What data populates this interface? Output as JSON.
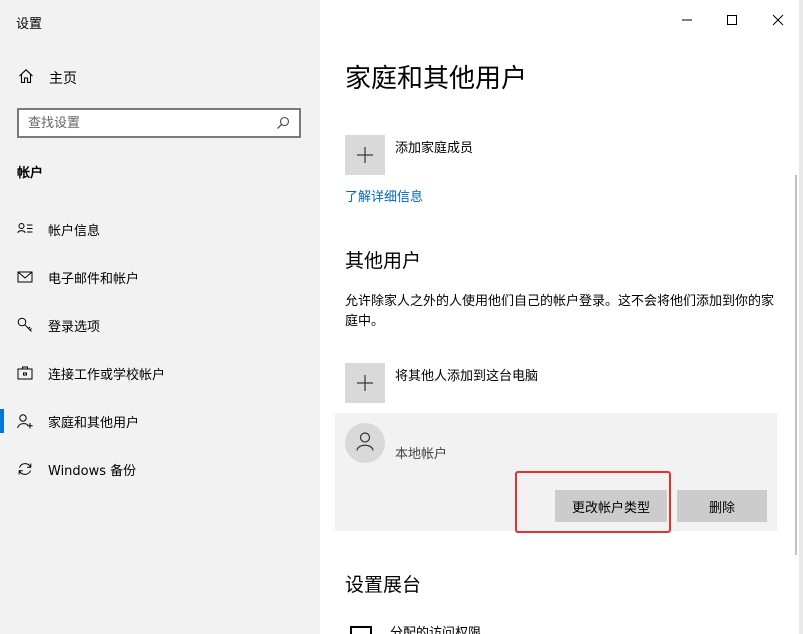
{
  "window": {
    "title": "设置",
    "controls": {
      "minimize": "minimize-icon",
      "maximize": "maximize-icon",
      "close": "close-icon"
    }
  },
  "sidebar": {
    "home_label": "主页",
    "search_placeholder": "查找设置",
    "section_label": "帐户",
    "items": [
      {
        "label": "帐户信息",
        "icon": "account-info-icon"
      },
      {
        "label": "电子邮件和帐户",
        "icon": "mail-icon"
      },
      {
        "label": "登录选项",
        "icon": "key-icon"
      },
      {
        "label": "连接工作或学校帐户",
        "icon": "briefcase-icon"
      },
      {
        "label": "家庭和其他用户",
        "icon": "add-person-icon",
        "active": true
      },
      {
        "label": "Windows 备份",
        "icon": "sync-icon"
      }
    ]
  },
  "main": {
    "title": "家庭和其他用户",
    "add_family_label": "添加家庭成员",
    "learn_more_link": "了解详细信息",
    "other_users_heading": "其他用户",
    "other_users_description": "允许除家人之外的人使用他们自己的帐户登录。这不会将他们添加到你的家庭中。",
    "add_other_label": "将其他人添加到这台电脑",
    "account": {
      "name": "本地帐户",
      "change_type_button": "更改帐户类型",
      "delete_button": "删除"
    },
    "kiosk_heading": "设置展台",
    "kiosk_item_label": "分配的访问权限"
  },
  "colors": {
    "accent": "#0078d7",
    "link": "#0067c0",
    "highlight_border": "#e0322f",
    "sidebar_bg": "#f2f2f2"
  }
}
